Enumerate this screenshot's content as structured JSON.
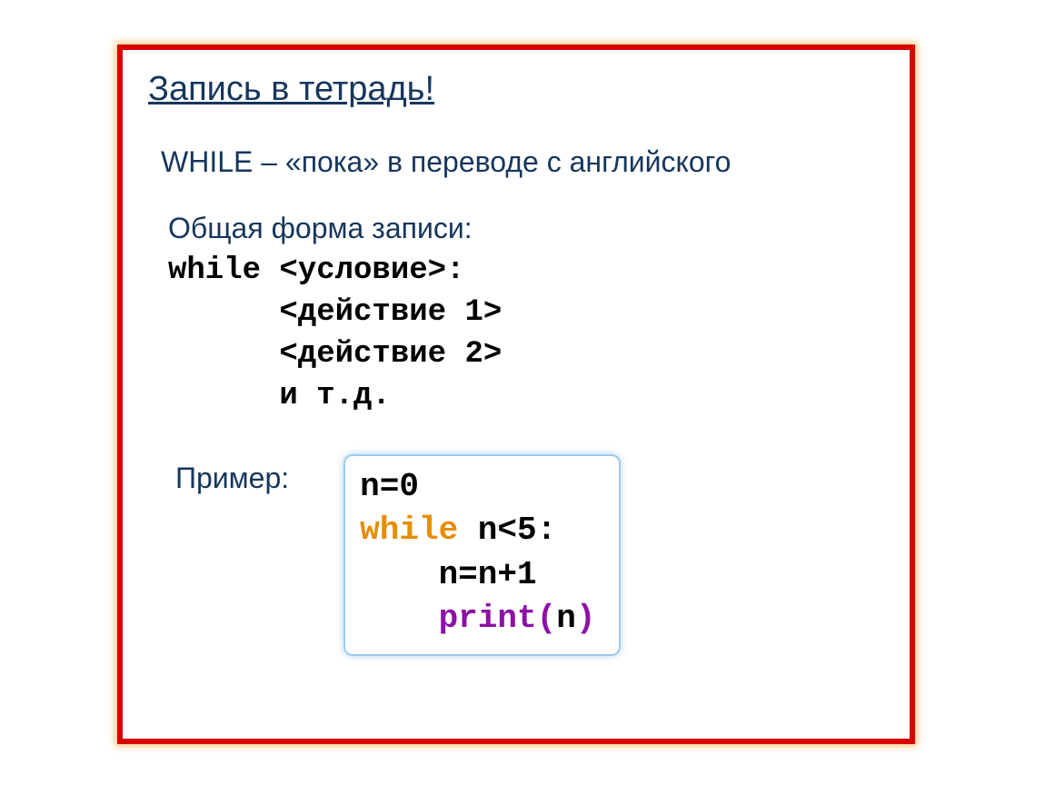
{
  "title": "Запись в тетрадь!",
  "note": "WHILE – «пока» в переводе с английского",
  "general_form_label": "Общая форма записи:",
  "general_form": {
    "line1": "while <условие>:",
    "line2": "      <действие 1>",
    "line3": "      <действие 2>",
    "line4": "      и т.д."
  },
  "example_label": "Пример:",
  "example": {
    "line1_a": "n=0",
    "line2_kw": "while",
    "line2_rest": " n<5:",
    "line3": "    n=n+1",
    "line4_indent": "    ",
    "line4_print": "print",
    "line4_paren_open": "(",
    "line4_arg": "n",
    "line4_paren_close": ")"
  }
}
